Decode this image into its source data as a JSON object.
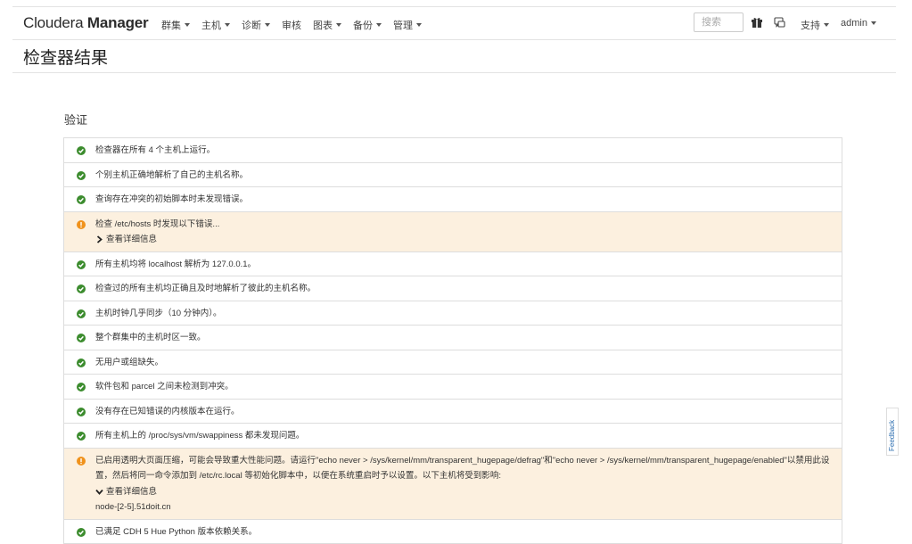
{
  "brand": {
    "light": "Cloudera ",
    "bold": "Manager"
  },
  "nav": [
    {
      "label": "群集",
      "dropdown": true
    },
    {
      "label": "主机",
      "dropdown": true
    },
    {
      "label": "诊断",
      "dropdown": true
    },
    {
      "label": "审核",
      "dropdown": false
    },
    {
      "label": "图表",
      "dropdown": true
    },
    {
      "label": "备份",
      "dropdown": true
    },
    {
      "label": "管理",
      "dropdown": true
    }
  ],
  "search": {
    "placeholder": "搜索"
  },
  "header_icons": {
    "parcel": "gift-icon",
    "tasks": "chat-icon"
  },
  "support_label": "支持",
  "user_label": "admin",
  "page_title": "检查器结果",
  "section_title": "验证",
  "colors": {
    "ok": "#3c8c2e",
    "warning": "#f0921c",
    "warning_bg": "#fcf0df",
    "link": "#2f6fb0"
  },
  "results": [
    {
      "status": "ok",
      "text": "检查器在所有 4 个主机上运行。"
    },
    {
      "status": "ok",
      "text": "个别主机正确地解析了自己的主机名称。"
    },
    {
      "status": "ok",
      "text": "查询存在冲突的初始脚本时未发现错误。"
    },
    {
      "status": "warning",
      "text": "检查 /etc/hosts 时发现以下错误...",
      "details": {
        "label": "查看详细信息",
        "expanded": false
      }
    },
    {
      "status": "ok",
      "text": "所有主机均将 localhost 解析为 127.0.0.1。"
    },
    {
      "status": "ok",
      "text": "检查过的所有主机均正确且及时地解析了彼此的主机名称。"
    },
    {
      "status": "ok",
      "text": "主机时钟几乎同步（10 分钟内）。"
    },
    {
      "status": "ok",
      "text": "整个群集中的主机时区一致。"
    },
    {
      "status": "ok",
      "text": "无用户或组缺失。"
    },
    {
      "status": "ok",
      "text": "软件包和 parcel 之间未检测到冲突。"
    },
    {
      "status": "ok",
      "text": "没有存在已知错误的内核版本在运行。"
    },
    {
      "status": "ok",
      "text": "所有主机上的 /proc/sys/vm/swappiness 都未发现问题。"
    },
    {
      "status": "warning",
      "text": "已启用透明大页面压缩，可能会导致重大性能问题。请运行\"echo never > /sys/kernel/mm/transparent_hugepage/defrag\"和\"echo never > /sys/kernel/mm/transparent_hugepage/enabled\"以禁用此设置，然后将同一命令添加到 /etc/rc.local 等初始化脚本中，以便在系统重启时予以设置。以下主机将受到影响:",
      "details": {
        "label": "查看详细信息",
        "expanded": true,
        "content": "node-[2-5].51doit.cn"
      }
    },
    {
      "status": "ok",
      "text": "已满足 CDH 5 Hue Python 版本依赖关系。"
    }
  ],
  "feedback_label": "Feedback"
}
